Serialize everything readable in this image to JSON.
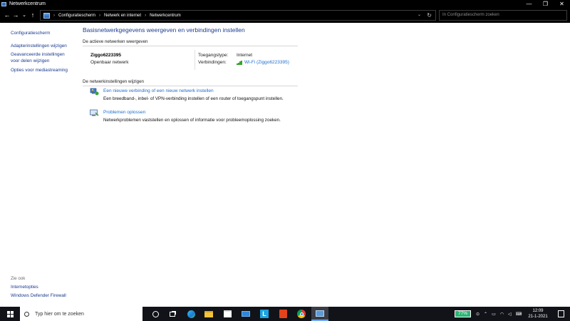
{
  "window": {
    "title": "Netwerkcentrum",
    "controls": [
      "—",
      "❐",
      "✕"
    ]
  },
  "nav": {
    "back": "←",
    "forward": "→",
    "recent": "⌄",
    "up": "↑"
  },
  "breadcrumb": {
    "items": [
      "Configuratiescherm",
      "Netwerk en internet",
      "Netwerkcentrum"
    ],
    "separator": "›"
  },
  "search": {
    "placeholder": "In Configuratiescherm zoeken"
  },
  "sidebar": {
    "items": [
      {
        "label": "Configuratiescherm"
      },
      {
        "label": "Adapterinstellingen wijzigen"
      },
      {
        "label": "Geavanceerde instellingen"
      },
      {
        "label": "voor delen wijzigen"
      },
      {
        "label": "Opties voor mediastreaming"
      }
    ],
    "see_also_label": "Zie ook",
    "see_also": [
      {
        "label": "Internetopties"
      },
      {
        "label": "Windows Defender Firewall"
      }
    ]
  },
  "main": {
    "title": "Basisnetwerkgegevens weergeven en verbindingen instellen",
    "active_section": "De actieve netwerken weergeven",
    "network_name": "Ziggo6223395",
    "network_type": "Openbaar netwerk",
    "access_type_label": "Toegangstype:",
    "access_type_value": "Internet",
    "connections_label": "Verbindingen:",
    "connections_value": "Wi-Fi (Ziggo6223395)",
    "change_section": "De netwerkinstellingen wijzigen",
    "tasks": [
      {
        "link": "Een nieuwe verbinding of een nieuw netwerk instellen",
        "desc": "Een breedband-, inbel- of VPN-verbinding instellen of een router of toegangspunt instellen.",
        "icon": "network-setup-icon"
      },
      {
        "link": "Problemen oplossen",
        "desc": "Netwerkproblemen vaststellen en oplossen of informatie voor probleemoplossing zoeken.",
        "icon": "troubleshoot-icon"
      }
    ]
  },
  "taskbar": {
    "search_placeholder": "Typ hier om te zoeken",
    "battery": "77%",
    "time": "12:09",
    "date": "21-1-2021",
    "apps": [
      "cortana-icon",
      "task-view-icon",
      "edge-icon",
      "file-explorer-icon",
      "store-icon",
      "mail-icon",
      "l-app-icon",
      "office-icon",
      "chrome-icon",
      "control-panel-icon"
    ]
  },
  "colors": {
    "link": "#1e6fd0",
    "title": "#1e3e92",
    "taskbar": "#111319"
  }
}
